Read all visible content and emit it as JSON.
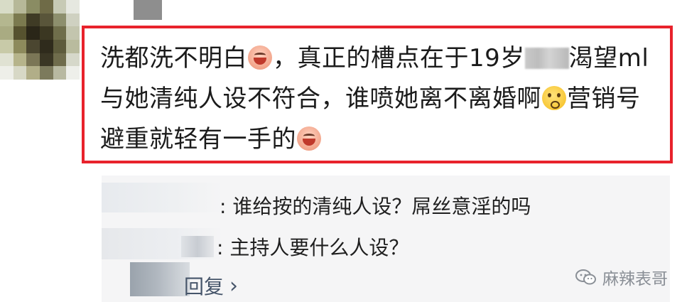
{
  "comment": {
    "seg1": "洗都洗不明白",
    "seg2": "，真正的槽点在于19岁",
    "seg3": "渴望ml与她清纯人设不符合，谁喷她离不离婚啊",
    "seg4": "营销号避重就轻有一手的"
  },
  "replies": [
    {
      "author_suffix": ":",
      "text": "谁给按的清纯人设？屌丝意淫的吗"
    },
    {
      "author_suffix": ":",
      "text": "主持人要什么人设？"
    }
  ],
  "reply_action": {
    "label": "回复",
    "chevron": "›"
  },
  "watermark": {
    "icon": "wechat-icon",
    "text": "麻辣表哥"
  },
  "colors": {
    "highlight_border": "#e8222c",
    "reply_bg": "#f5f5f6",
    "link": "#46556a"
  },
  "emoji_names": [
    "laughing-face-emoji",
    "thinking-face-emoji",
    "laughing-face-emoji"
  ]
}
